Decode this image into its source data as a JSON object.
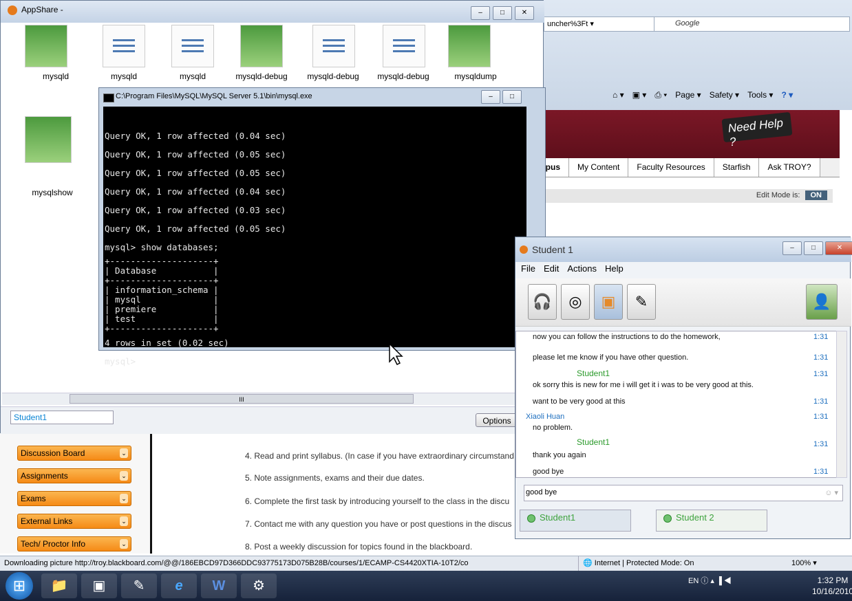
{
  "ie": {
    "address_tail": "uncher%3Ft ▾",
    "search_placeholder": "Google",
    "commands": [
      "Page ▾",
      "Safety ▾",
      "Tools ▾"
    ],
    "need_help": "Need Help ?",
    "tabs": [
      "mpus",
      "My Content",
      "Faculty Resources",
      "Starfish",
      "Ask TROY?"
    ],
    "edit_mode_label": "Edit Mode is:",
    "edit_mode_value": "ON",
    "left_menu": [
      "Discussion Board",
      "Assignments",
      "Exams",
      "External Links",
      "Tech/ Proctor Info"
    ],
    "list_items": [
      "4.  Read and print syllabus. (In case if you have extraordinary circumstand",
      "5.  Note assignments, exams and their due dates.",
      "6.  Complete the first task by introducing yourself to the class in the discu",
      "7.  Contact me with any question you have or post questions in the discus",
      "8.  Post a  weekly discussion for topics found in the blackboard."
    ],
    "status_text": "Downloading picture http://troy.blackboard.com/@@/186EBCD97D366DDC93775173D075B28B/courses/1/ECAMP-CS4420XTIA-10T2/co",
    "status_zone": "Internet | Protected Mode: On",
    "status_zoom": "100%  ▾"
  },
  "appshare": {
    "title": "AppShare -",
    "files": [
      "mysqld",
      "mysqld",
      "mysqld",
      "mysqld-debug",
      "mysqld-debug",
      "mysqld-debug",
      "mysqldump"
    ],
    "file2": "mysqlshow",
    "scroll_label": "III",
    "student_label": "Student1",
    "options_label": "Options"
  },
  "console": {
    "title": "C:\\Program Files\\MySQL\\MySQL Server 5.1\\bin\\mysql.exe",
    "lines": [
      "Query OK, 1 row affected (0.04 sec)",
      "Query OK, 1 row affected (0.05 sec)",
      "Query OK, 1 row affected (0.05 sec)",
      "Query OK, 1 row affected (0.04 sec)",
      "Query OK, 1 row affected (0.03 sec)",
      "Query OK, 1 row affected (0.05 sec)"
    ],
    "command": "mysql> show databases;",
    "table": "+--------------------+\n| Database           |\n+--------------------+\n| information_schema |\n| mysql              |\n| premiere           |\n| test               |\n+--------------------+",
    "result": "4 rows in set (0.02 sec)",
    "prompt": "mysql>"
  },
  "chat": {
    "title": "Student 1",
    "menu": [
      "File",
      "Edit",
      "Actions",
      "Help"
    ],
    "messages": {
      "m0": "now you can follow the instructions to do the homework,",
      "m1": "please let me know if you have other question.",
      "s1": "Student1",
      "m2": "ok sorry this is new for me i will get it i was to be very good at this.",
      "m3": "want to be very good at this",
      "s2": "Xiaoli Huan",
      "m4": "no problem.",
      "s3": "Student1",
      "m5": "thank you again",
      "m6": "good bye"
    },
    "times": [
      "1:31",
      "1:31",
      "1:31",
      "1:31",
      "1:31",
      "1:31",
      "1:31"
    ],
    "input_value": "good bye",
    "tabs": [
      "Student1",
      "Student 2"
    ]
  },
  "taskbar": {
    "lang": "EN",
    "time": "1:32 PM",
    "date": "10/16/2010"
  }
}
